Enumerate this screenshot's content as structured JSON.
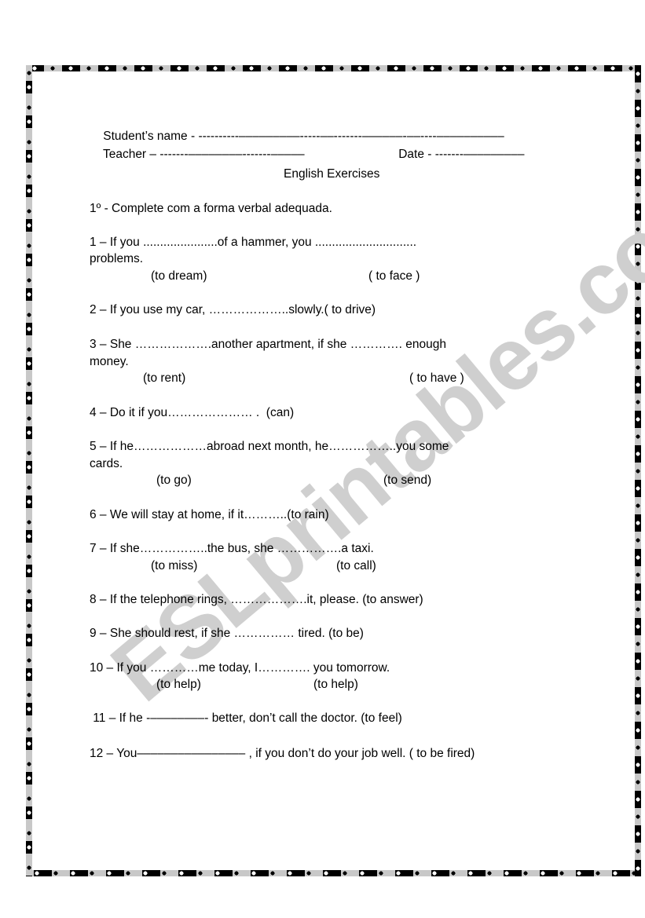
{
  "header": {
    "student_label": "Student’s name - ",
    "student_blank": "----------–––––––––-----––-------––––––-––----––––––––––",
    "teacher_label": "Teacher – ",
    "teacher_blank": "-------––––––––-------–––––",
    "date_label": "Date - ",
    "date_blank": "-------–––––––––"
  },
  "title": "English Exercises",
  "instruction": "1º - Complete com a forma verbal adequada.",
  "exercises": [
    {
      "text": "1 – If you ......................of a hammer, you ..............................",
      "cont": "problems.",
      "hints": [
        "(to dream)",
        "( to face )"
      ]
    },
    {
      "text": "2 – If you use my car, ………………..slowly.( to drive)"
    },
    {
      "text": "3 – She ……………….another apartment, if she …………. enough",
      "cont": "money.",
      "hints": [
        "(to rent)",
        "( to have )"
      ]
    },
    {
      "text": "4 – Do it if you………………… .  (can)"
    },
    {
      "text": "5 – If he………………abroad next month, he……………..you some",
      "cont": "cards.",
      "hints": [
        "(to go)",
        "(to send)"
      ]
    },
    {
      "text": "6 – We will stay at home, if it………..(to rain)"
    },
    {
      "text": "7 – If she……………..the bus, she …………….a taxi.",
      "hints": [
        "(to miss)",
        "(to call)"
      ]
    },
    {
      "text": "8 – If the telephone rings, ……………….it, please. (to answer)"
    },
    {
      "text": "9 – She should rest, if she …………… tired. (to be)"
    },
    {
      "text": "10 – If you …………me today, I…………. you tomorrow.",
      "hints": [
        "(to help)",
        "(to help)"
      ]
    },
    {
      "text": " 11 – If he -––––––––- better, don’t call the doctor. (to feel)"
    },
    {
      "text": "12 – You–––––––––––––––– , if you don’t do your job well. ( to be fired)"
    }
  ],
  "watermark": "ESLprintables.com"
}
